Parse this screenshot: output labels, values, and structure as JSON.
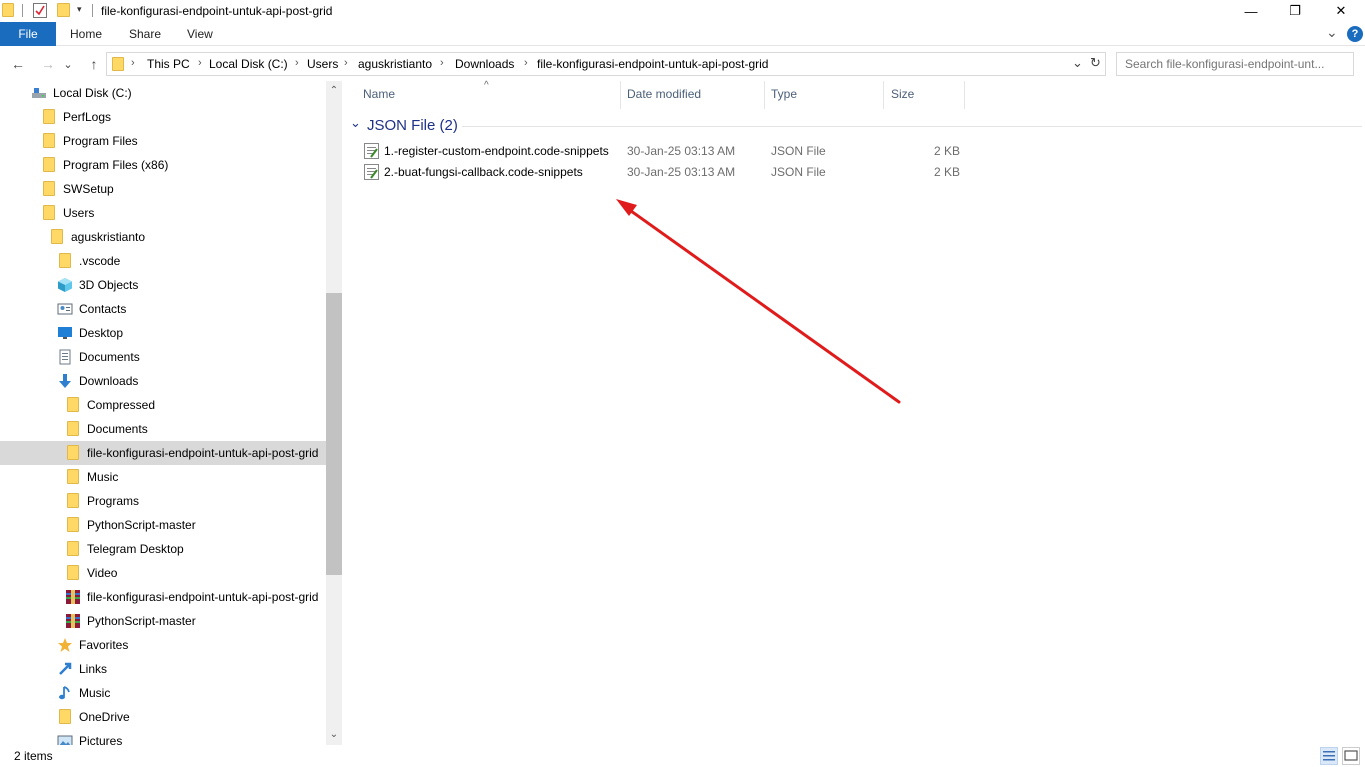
{
  "window": {
    "title": "file-konfigurasi-endpoint-untuk-api-post-grid",
    "minimize_glyph": "—",
    "restore_glyph": "❐",
    "close_glyph": "✕"
  },
  "ribbon": {
    "tabs": [
      {
        "label": "File"
      },
      {
        "label": "Home"
      },
      {
        "label": "Share"
      },
      {
        "label": "View"
      }
    ],
    "expand_glyph": "⌄",
    "help_glyph": "?"
  },
  "nav": {
    "back_glyph": "←",
    "forward_glyph": "→",
    "recent_glyph": "⌄",
    "up_glyph": "↑"
  },
  "address": {
    "crumbs": [
      "This PC",
      "Local Disk (C:)",
      "Users",
      "aguskristianto",
      "Downloads",
      "file-konfigurasi-endpoint-untuk-api-post-grid"
    ],
    "separator": "›",
    "dropdown_glyph": "⌄",
    "refresh_glyph": "↻"
  },
  "search": {
    "placeholder": "Search file-konfigurasi-endpoint-unt..."
  },
  "tree": [
    {
      "label": "Local Disk (C:)",
      "icon": "drive-icon"
    },
    {
      "label": "PerfLogs",
      "icon": "folder-icon"
    },
    {
      "label": "Program Files",
      "icon": "folder-icon"
    },
    {
      "label": "Program Files (x86)",
      "icon": "folder-icon"
    },
    {
      "label": "SWSetup",
      "icon": "folder-icon"
    },
    {
      "label": "Users",
      "icon": "folder-icon"
    },
    {
      "label": "aguskristianto",
      "icon": "user-folder-icon"
    },
    {
      "label": ".vscode",
      "icon": "folder-icon"
    },
    {
      "label": "3D Objects",
      "icon": "3d-objects-icon"
    },
    {
      "label": "Contacts",
      "icon": "contacts-icon"
    },
    {
      "label": "Desktop",
      "icon": "desktop-icon"
    },
    {
      "label": "Documents",
      "icon": "documents-icon"
    },
    {
      "label": "Downloads",
      "icon": "downloads-icon"
    },
    {
      "label": "Compressed",
      "icon": "folder-icon"
    },
    {
      "label": "Documents",
      "icon": "folder-icon"
    },
    {
      "label": "file-konfigurasi-endpoint-untuk-api-post-grid",
      "icon": "folder-icon"
    },
    {
      "label": "Music",
      "icon": "folder-icon"
    },
    {
      "label": "Programs",
      "icon": "folder-icon"
    },
    {
      "label": "PythonScript-master",
      "icon": "folder-icon"
    },
    {
      "label": "Telegram Desktop",
      "icon": "folder-icon"
    },
    {
      "label": "Video",
      "icon": "folder-icon"
    },
    {
      "label": "file-konfigurasi-endpoint-untuk-api-post-grid",
      "icon": "archive-icon"
    },
    {
      "label": "PythonScript-master",
      "icon": "archive-icon"
    },
    {
      "label": "Favorites",
      "icon": "star-icon"
    },
    {
      "label": "Links",
      "icon": "links-icon"
    },
    {
      "label": "Music",
      "icon": "music-icon"
    },
    {
      "label": "OneDrive",
      "icon": "folder-icon"
    },
    {
      "label": "Pictures",
      "icon": "pictures-icon"
    }
  ],
  "tree_selected_index": 15,
  "scroll": {
    "up_glyph": "⌃",
    "down_glyph": "⌄"
  },
  "columns": {
    "name": "Name",
    "date": "Date modified",
    "type": "Type",
    "size": "Size",
    "sort_glyph": "^"
  },
  "group": {
    "label": "JSON File (2)",
    "collapse_glyph": "⌄"
  },
  "files": [
    {
      "name": "1.-register-custom-endpoint.code-snippets",
      "date": "30-Jan-25 03:13 AM",
      "type": "JSON File",
      "size": "2 KB"
    },
    {
      "name": "2.-buat-fungsi-callback.code-snippets",
      "date": "30-Jan-25 03:13 AM",
      "type": "JSON File",
      "size": "2 KB"
    }
  ],
  "annotation": {
    "color": "#e01b1b"
  },
  "status": {
    "items": "2 items"
  }
}
